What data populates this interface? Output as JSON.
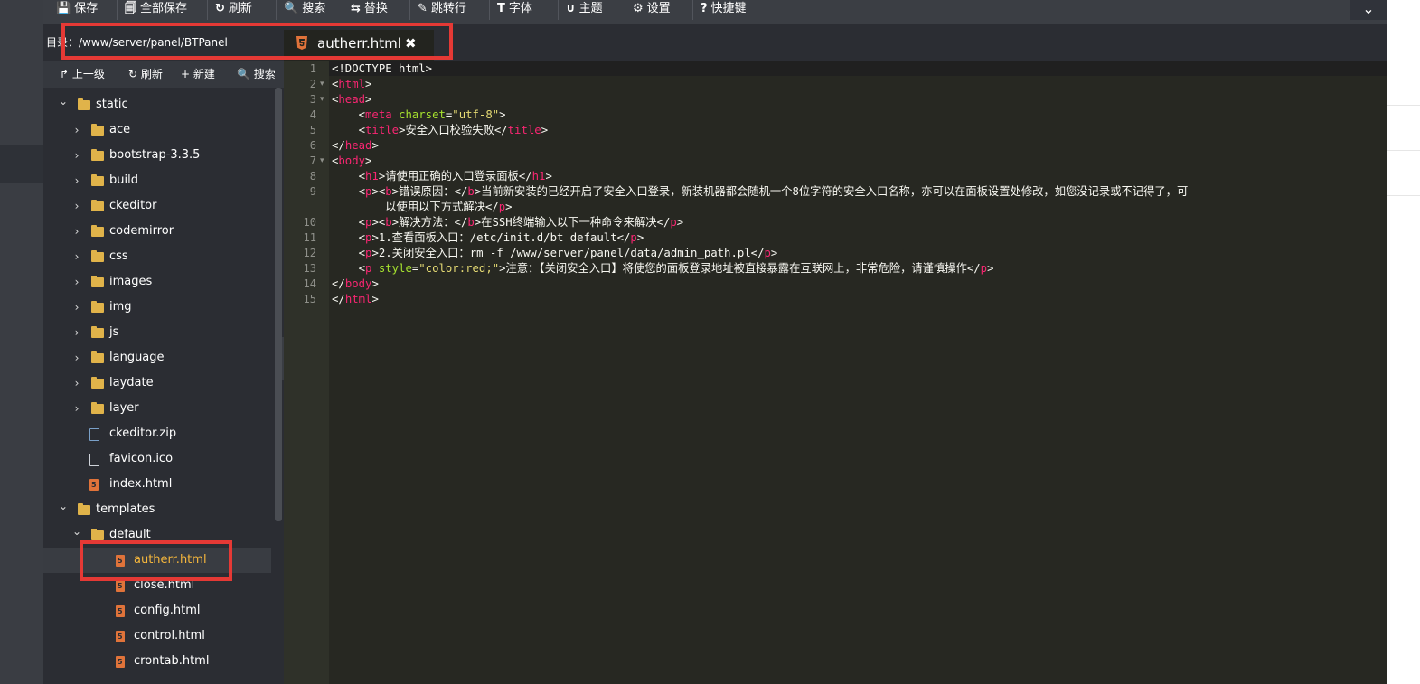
{
  "toolbar": {
    "items": [
      {
        "icon": "save-icon",
        "glyph": "💾",
        "label": "保存"
      },
      {
        "icon": "save-all-icon",
        "glyph": "🗐",
        "label": "全部保存"
      },
      {
        "icon": "refresh-icon",
        "glyph": "↻",
        "label": "刷新"
      },
      {
        "icon": "search-icon",
        "glyph": "🔍",
        "label": "搜索"
      },
      {
        "icon": "replace-icon",
        "glyph": "⇆",
        "label": "替换"
      },
      {
        "icon": "jump-icon",
        "glyph": "✎",
        "label": "跳转行"
      },
      {
        "icon": "font-icon",
        "glyph": "T",
        "label": "字体"
      },
      {
        "icon": "theme-icon",
        "glyph": "∪",
        "label": "主题"
      },
      {
        "icon": "gear-icon",
        "glyph": "⚙",
        "label": "设置"
      },
      {
        "icon": "help-icon",
        "glyph": "?",
        "label": "快捷键"
      }
    ],
    "collapse_glyph": "⌄"
  },
  "path": {
    "label": "目录：",
    "value": "/www/server/panel/BTPanel"
  },
  "tab": {
    "label": "autherr.html",
    "close_glyph": "✖"
  },
  "tree_tools": [
    {
      "icon": "up-icon",
      "glyph": "↱",
      "label": "上一级"
    },
    {
      "icon": "refresh-icon",
      "glyph": "↻",
      "label": "刷新"
    },
    {
      "icon": "plus-icon",
      "glyph": "+",
      "label": "新建"
    },
    {
      "icon": "search-icon",
      "glyph": "🔍",
      "label": "搜索"
    }
  ],
  "tree": [
    {
      "label": "static",
      "type": "folder",
      "depth": 0,
      "open": true
    },
    {
      "label": "ace",
      "type": "folder",
      "depth": 1,
      "open": false
    },
    {
      "label": "bootstrap-3.3.5",
      "type": "folder",
      "depth": 1,
      "open": false
    },
    {
      "label": "build",
      "type": "folder",
      "depth": 1,
      "open": false
    },
    {
      "label": "ckeditor",
      "type": "folder",
      "depth": 1,
      "open": false
    },
    {
      "label": "codemirror",
      "type": "folder",
      "depth": 1,
      "open": false
    },
    {
      "label": "css",
      "type": "folder",
      "depth": 1,
      "open": false
    },
    {
      "label": "images",
      "type": "folder",
      "depth": 1,
      "open": false
    },
    {
      "label": "img",
      "type": "folder",
      "depth": 1,
      "open": false
    },
    {
      "label": "js",
      "type": "folder",
      "depth": 1,
      "open": false
    },
    {
      "label": "language",
      "type": "folder",
      "depth": 1,
      "open": false
    },
    {
      "label": "laydate",
      "type": "folder",
      "depth": 1,
      "open": false
    },
    {
      "label": "layer",
      "type": "folder",
      "depth": 1,
      "open": false
    },
    {
      "label": "ckeditor.zip",
      "type": "zip",
      "depth": 1
    },
    {
      "label": "favicon.ico",
      "type": "file",
      "depth": 1
    },
    {
      "label": "index.html",
      "type": "html",
      "depth": 1
    },
    {
      "label": "templates",
      "type": "folder",
      "depth": 0,
      "open": true
    },
    {
      "label": "default",
      "type": "folder",
      "depth": 1,
      "open": true
    },
    {
      "label": "autherr.html",
      "type": "html",
      "depth": 2,
      "selected": true
    },
    {
      "label": "close.html",
      "type": "html",
      "depth": 2
    },
    {
      "label": "config.html",
      "type": "html",
      "depth": 2
    },
    {
      "label": "control.html",
      "type": "html",
      "depth": 2
    },
    {
      "label": "crontab.html",
      "type": "html",
      "depth": 2
    }
  ],
  "code": [
    {
      "n": "1",
      "fold": "",
      "html": "&lt;!DOCTYPE html&gt;"
    },
    {
      "n": "2",
      "fold": "▾",
      "html": "&lt;<span class=\"tg\">html</span>&gt;"
    },
    {
      "n": "3",
      "fold": "▾",
      "html": "&lt;<span class=\"tg\">head</span>&gt;"
    },
    {
      "n": "4",
      "fold": "",
      "html": "    &lt;<span class=\"tg\">meta</span> <span class=\"at\">charset</span>=<span class=\"st\">\"utf-8\"</span>&gt;"
    },
    {
      "n": "5",
      "fold": "",
      "html": "    &lt;<span class=\"tg\">title</span>&gt;安全入口校验失败&lt;/<span class=\"tg\">title</span>&gt;"
    },
    {
      "n": "6",
      "fold": "",
      "html": "&lt;/<span class=\"tg\">head</span>&gt;"
    },
    {
      "n": "7",
      "fold": "▾",
      "html": "&lt;<span class=\"tg\">body</span>&gt;"
    },
    {
      "n": "8",
      "fold": "",
      "html": "    &lt;<span class=\"tg\">h1</span>&gt;请使用正确的入口登录面板&lt;/<span class=\"tg\">h1</span>&gt;"
    },
    {
      "n": "9",
      "fold": "",
      "html": "    &lt;<span class=\"tg\">p</span>&gt;&lt;<span class=\"tg\">b</span>&gt;错误原因：&lt;/<span class=\"tg\">b</span>&gt;当前新安装的已经开启了安全入口登录，新装机器都会随机一个8位字符的安全入口名称，亦可以在面板设置处修改，如您没记录或不记得了，可"
    },
    {
      "n": "",
      "fold": "",
      "html": "        以使用以下方式解决&lt;/<span class=\"tg\">p</span>&gt;"
    },
    {
      "n": "10",
      "fold": "",
      "html": "    &lt;<span class=\"tg\">p</span>&gt;&lt;<span class=\"tg\">b</span>&gt;解决方法：&lt;/<span class=\"tg\">b</span>&gt;在SSH终端输入以下一种命令来解决&lt;/<span class=\"tg\">p</span>&gt;"
    },
    {
      "n": "11",
      "fold": "",
      "html": "    &lt;<span class=\"tg\">p</span>&gt;1.查看面板入口：/etc/init.d/bt default&lt;/<span class=\"tg\">p</span>&gt;"
    },
    {
      "n": "12",
      "fold": "",
      "html": "    &lt;<span class=\"tg\">p</span>&gt;2.关闭安全入口：rm -f /www/server/panel/data/admin_path.pl&lt;/<span class=\"tg\">p</span>&gt;"
    },
    {
      "n": "13",
      "fold": "",
      "html": "    &lt;<span class=\"tg\">p</span> <span class=\"at\">style</span>=<span class=\"st\">\"color:red;\"</span>&gt;注意：【关闭安全入口】将使您的面板登录地址被直接暴露在互联网上，非常危险，请谨慎操作&lt;/<span class=\"tg\">p</span>&gt;"
    },
    {
      "n": "14",
      "fold": "",
      "html": "&lt;/<span class=\"tg\">body</span>&gt;"
    },
    {
      "n": "15",
      "fold": "",
      "html": "&lt;/<span class=\"tg\">html</span>&gt;"
    }
  ],
  "collapse_handle_glyph": "‹",
  "colors": {
    "highlight": "#e53935",
    "selected_text": "#f6b73c",
    "folder": "#e0b34a",
    "html_icon": "#e0733a"
  }
}
